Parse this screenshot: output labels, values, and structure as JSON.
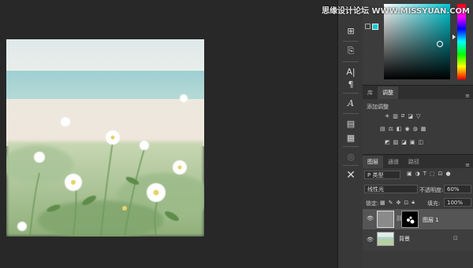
{
  "watermark": "思缘设计论坛 WWW.MISSYUAN.COM",
  "panels": {
    "tabs": [
      "库",
      "调整"
    ],
    "adjustments_title": "添加调整"
  },
  "layers": {
    "tabs": [
      "图层",
      "通道",
      "路径"
    ],
    "filter_label": "P 类型",
    "blend_mode": "线性光",
    "opacity_label": "不透明度:",
    "opacity_value": "60%",
    "lock_label": "锁定:",
    "fill_label": "填充:",
    "fill_value": "100%",
    "items": [
      {
        "name": "图层 1"
      },
      {
        "name": "背景"
      }
    ]
  },
  "colors": {
    "accent": "#00c8d4",
    "panel_bg": "#3a3a3a",
    "canvas_bg": "#282828"
  },
  "tools": [
    "properties-icon",
    "brush-history-icon",
    "character-icon",
    "paragraph-icon",
    "glyph-icon",
    "notes-icon",
    "stamp-icon",
    "smudge-icon",
    "tools-icon"
  ]
}
